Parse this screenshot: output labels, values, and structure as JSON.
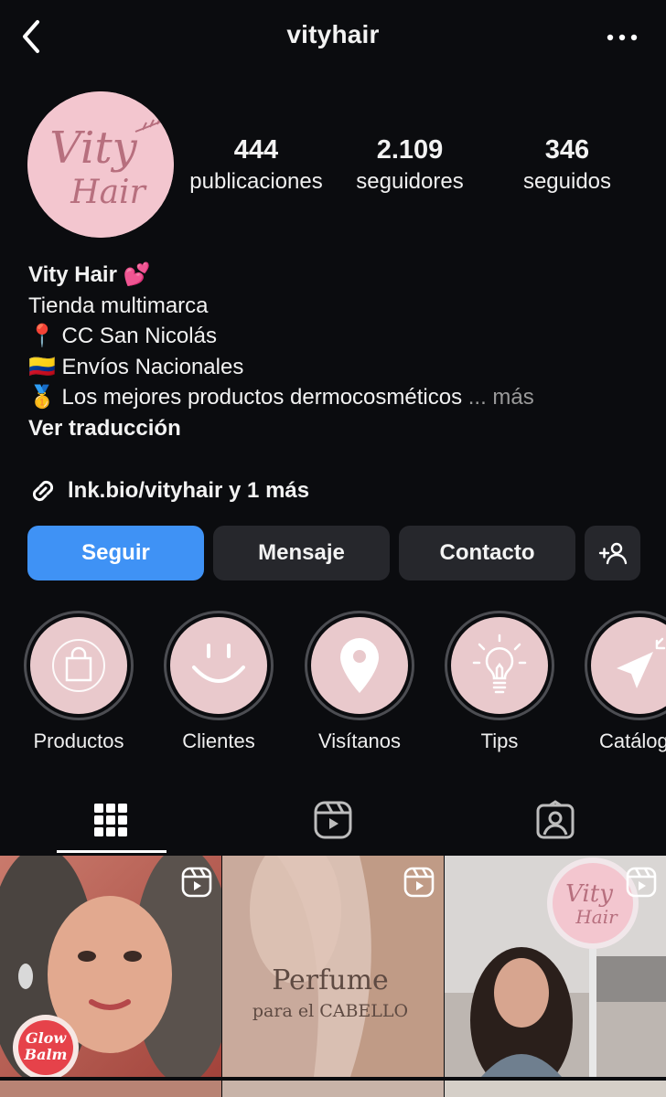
{
  "header": {
    "username": "vityhair"
  },
  "avatar": {
    "logo_line1": "Vity",
    "logo_line2": "Hair"
  },
  "stats": [
    {
      "value": "444",
      "label": "publicaciones"
    },
    {
      "value": "2.109",
      "label": "seguidores"
    },
    {
      "value": "346",
      "label": "seguidos"
    }
  ],
  "bio": {
    "name": "Vity Hair 💕",
    "lines": [
      "Tienda multimarca",
      "📍 CC San Nicolás",
      "🇨🇴 Envíos Nacionales",
      "🥇 Los mejores productos dermocosméticos"
    ],
    "more": "... más",
    "translate": "Ver traducción",
    "link": "lnk.bio/vityhair y 1 más"
  },
  "buttons": {
    "follow": "Seguir",
    "message": "Mensaje",
    "contact": "Contacto"
  },
  "highlights": [
    {
      "label": "Productos",
      "icon": "shopping-bag-icon"
    },
    {
      "label": "Clientes",
      "icon": "smile-icon"
    },
    {
      "label": "Visítanos",
      "icon": "location-pin-icon"
    },
    {
      "label": "Tips",
      "icon": "lightbulb-icon"
    },
    {
      "label": "Catálogo",
      "icon": "cursor-icon"
    }
  ],
  "tabs": [
    {
      "name": "grid",
      "icon": "grid-icon",
      "active": true
    },
    {
      "name": "reels",
      "icon": "reels-icon",
      "active": false
    },
    {
      "name": "tagged",
      "icon": "tagged-icon",
      "active": false
    }
  ],
  "posts": [
    {
      "caption_line1": "Glow",
      "caption_line2": "Balm"
    },
    {
      "caption_line1": "Perfume",
      "caption_line2": "para el CABELLO"
    },
    {
      "caption_line1": "Vity",
      "caption_line2": "Hair"
    }
  ],
  "colors": {
    "background": "#0b0c0f",
    "accent": "#3f92f5",
    "button": "#26272c",
    "pink": "#f3c6cf"
  }
}
